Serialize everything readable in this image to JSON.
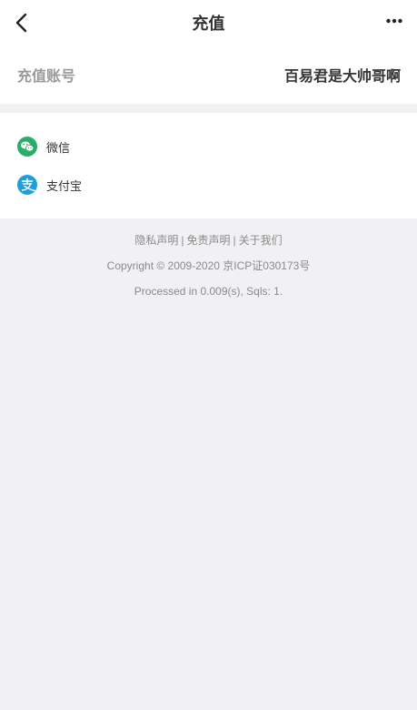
{
  "navbar": {
    "title": "充值",
    "back_icon": "chevron-left-icon",
    "more_icon": "more-horizontal-icon"
  },
  "account": {
    "label": "充值账号",
    "value": "百易君是大帅哥啊"
  },
  "payment_methods": [
    {
      "label": "微信",
      "icon": "wechat-icon",
      "color": "#2aae67"
    },
    {
      "label": "支付宝",
      "icon": "alipay-icon",
      "color": "#1e9fdd"
    }
  ],
  "footer": {
    "links": [
      {
        "label": "隐私声明"
      },
      {
        "label": "免责声明"
      },
      {
        "label": "关于我们"
      }
    ],
    "separator": "|",
    "copyright": "Copyright © 2009-2020 京ICP证030173号",
    "processed": "Processed in 0.009(s), Sqls: 1."
  },
  "colors": {
    "page_background": "#f1f1f4",
    "card_background": "#ffffff",
    "title_text": "#333333",
    "muted_text": "#999999",
    "footer_text": "#8a8a8a"
  }
}
